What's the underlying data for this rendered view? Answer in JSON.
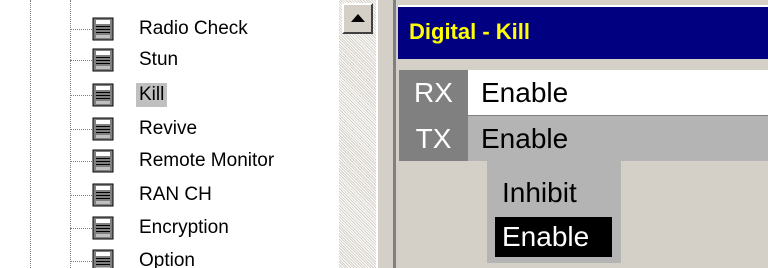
{
  "tree": {
    "items": [
      {
        "label": "Radio Check",
        "selected": false
      },
      {
        "label": "Stun",
        "selected": false
      },
      {
        "label": "Kill",
        "selected": true
      },
      {
        "label": "Revive",
        "selected": false
      },
      {
        "label": "Remote Monitor",
        "selected": false
      },
      {
        "label": "RAN CH",
        "selected": false
      },
      {
        "label": "Encryption",
        "selected": false
      },
      {
        "label": "Option",
        "selected": false
      }
    ],
    "icon": "device-icon"
  },
  "scrollbar": {
    "up_icon": "scroll-up-arrow-icon"
  },
  "panel": {
    "title": "Digital - Kill",
    "rows": [
      {
        "key": "RX",
        "value": "Enable"
      },
      {
        "key": "TX",
        "value": "Enable"
      }
    ]
  },
  "dropdown": {
    "options": [
      "Inhibit",
      "Enable"
    ],
    "selected": "Enable"
  },
  "colors": {
    "title_bg": "#000080",
    "title_text": "#ffff00",
    "key_bg": "#808080",
    "selected_row_bg": "#b4b4b4"
  }
}
